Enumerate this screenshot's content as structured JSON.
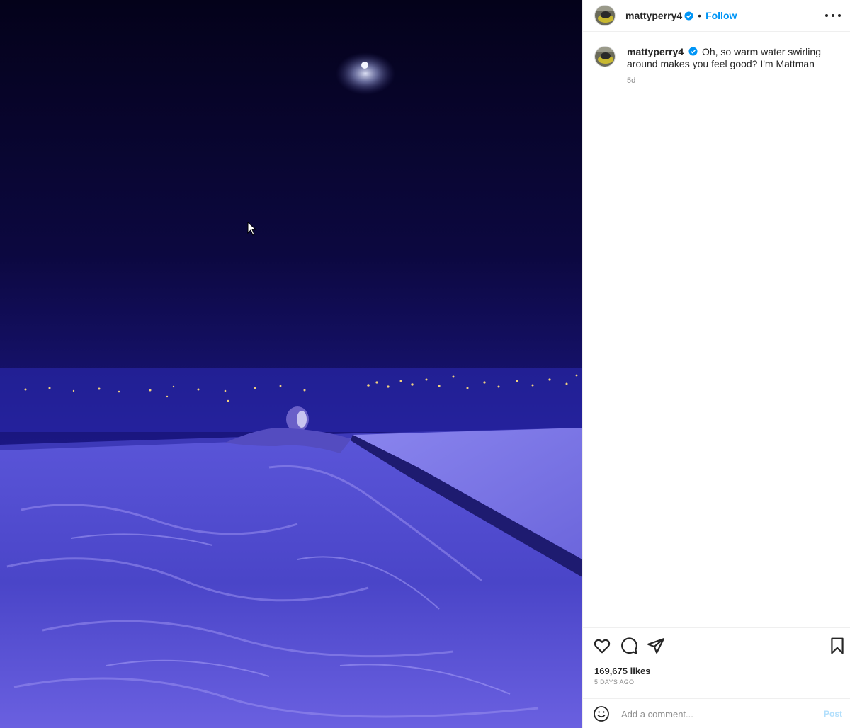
{
  "header": {
    "username": "mattyperry4",
    "separator": "•",
    "follow_label": "Follow",
    "more_icon": "more-horizontal-icon"
  },
  "caption": {
    "username": "mattyperry4",
    "text": "Oh, so warm water swirling around makes you feel good? I'm Mattman",
    "time": "5d"
  },
  "actions": {
    "icons": [
      "heart-icon",
      "comment-icon",
      "share-icon",
      "bookmark-icon"
    ]
  },
  "likes": "169,675 likes",
  "posted_ago": "5 DAYS AGO",
  "comment": {
    "placeholder": "Add a comment...",
    "post_label": "Post"
  },
  "colors": {
    "accent": "#0095f6",
    "verified": "#0095f6",
    "post_disabled": "#b2dffc"
  }
}
